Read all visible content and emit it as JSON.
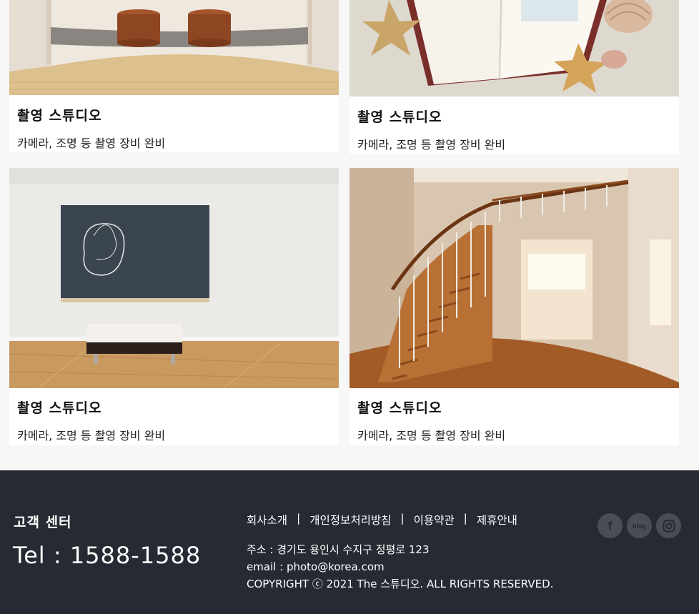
{
  "cards": [
    {
      "title": "촬영 스튜디오",
      "desc": "카메라, 조명 등 촬영 장비 완비"
    },
    {
      "title": "촬영 스튜디오",
      "desc": "카메라, 조명 등 촬영 장비 완비"
    },
    {
      "title": "촬영 스튜디오",
      "desc": "카메라, 조명 등 촬영 장비 완비"
    },
    {
      "title": "촬영 스튜디오",
      "desc": "카메라, 조명 등 촬영 장비 완비"
    }
  ],
  "footer": {
    "cs_title": "고객 센터",
    "cs_phone": "Tel : 1588-1588",
    "links": [
      "회사소개",
      "개인정보처리방침",
      "이용약관",
      "제휴안내"
    ],
    "separator": "|",
    "address": "주소 : 경기도 용인시 수지구 정평로 123",
    "email": "email : photo@korea.com",
    "copyright": "COPYRIGHT ⓒ 2021 The 스튜디오. ALL RIGHTS RESERVED.",
    "social": [
      {
        "icon": "facebook-icon",
        "label": "f"
      },
      {
        "icon": "blog-icon",
        "label": "blog"
      },
      {
        "icon": "instagram-icon",
        "label": ""
      }
    ]
  },
  "colors": {
    "page_bg": "#f7f7f7",
    "footer_bg": "#262a33",
    "social_bg": "#4a4d55"
  }
}
